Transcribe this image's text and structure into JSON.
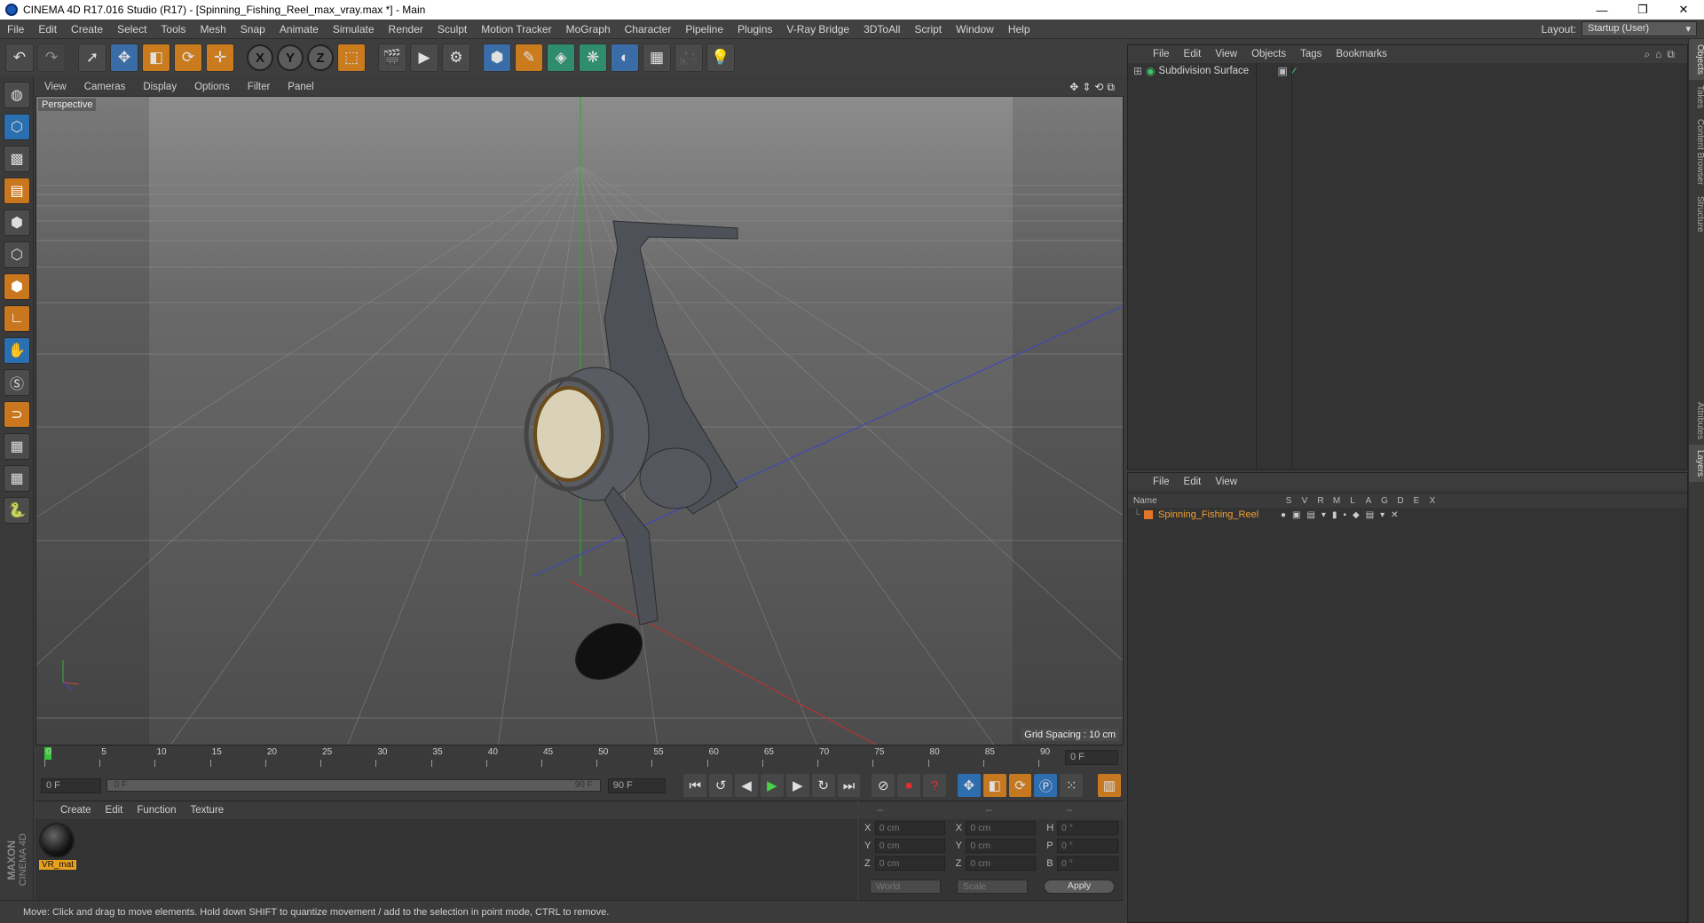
{
  "window": {
    "title": "CINEMA 4D R17.016 Studio (R17) - [Spinning_Fishing_Reel_max_vray.max *] - Main",
    "minimize": "—",
    "restore": "❐",
    "close": "✕"
  },
  "menubar": {
    "items": [
      "File",
      "Edit",
      "Create",
      "Select",
      "Tools",
      "Mesh",
      "Snap",
      "Animate",
      "Simulate",
      "Render",
      "Sculpt",
      "Motion Tracker",
      "MoGraph",
      "Character",
      "Pipeline",
      "Plugins",
      "V-Ray Bridge",
      "3DToAll",
      "Script",
      "Window",
      "Help"
    ],
    "layout_label": "Layout:",
    "layout_value": "Startup (User)"
  },
  "toolbar": {
    "x_label": "X",
    "y_label": "Y",
    "z_label": "Z"
  },
  "viewport": {
    "menu": [
      "View",
      "Cameras",
      "Display",
      "Options",
      "Filter",
      "Panel"
    ],
    "camera_label": "Perspective",
    "grid_spacing": "Grid Spacing : 10 cm"
  },
  "timeline": {
    "ticks": [
      "0",
      "5",
      "10",
      "15",
      "20",
      "25",
      "30",
      "35",
      "40",
      "45",
      "50",
      "55",
      "60",
      "65",
      "70",
      "75",
      "80",
      "85",
      "90"
    ],
    "current_frame": "0 F",
    "start_field": "0 F",
    "range_start": "0 F",
    "range_end": "90 F",
    "end_field": "90 F"
  },
  "materials": {
    "menu": [
      "Create",
      "Edit",
      "Function",
      "Texture"
    ],
    "items": [
      {
        "name": "VR_mat"
      }
    ]
  },
  "coordinates": {
    "headers": [
      "--",
      "--",
      "--"
    ],
    "rows": [
      {
        "a": "X",
        "av": "0 cm",
        "b": "X",
        "bv": "0 cm",
        "c": "H",
        "cv": "0 °"
      },
      {
        "a": "Y",
        "av": "0 cm",
        "b": "Y",
        "bv": "0 cm",
        "c": "P",
        "cv": "0 °"
      },
      {
        "a": "Z",
        "av": "0 cm",
        "b": "Z",
        "bv": "0 cm",
        "c": "B",
        "cv": "0 °"
      }
    ],
    "mode1": "World",
    "mode2": "Scale",
    "apply": "Apply"
  },
  "status": {
    "text": "Move: Click and drag to move elements. Hold down SHIFT to quantize movement / add to the selection in point mode, CTRL to remove."
  },
  "objects_panel": {
    "menu": [
      "File",
      "Edit",
      "View",
      "Objects",
      "Tags",
      "Bookmarks"
    ],
    "items": [
      {
        "name": "Subdivision Surface"
      }
    ]
  },
  "layers_panel": {
    "menu": [
      "File",
      "Edit",
      "View"
    ],
    "columns": {
      "name": "Name",
      "flags": [
        "S",
        "V",
        "R",
        "M",
        "L",
        "A",
        "G",
        "D",
        "E",
        "X"
      ]
    },
    "rows": [
      {
        "name": "Spinning_Fishing_Reel"
      }
    ]
  },
  "right_tabs": [
    "Objects",
    "Takes",
    "Content Browser",
    "Structure",
    "Attributes",
    "Layers"
  ],
  "branding": {
    "line1": "MAXON",
    "line2": "CINEMA 4D"
  },
  "colors": {
    "accent_blue": "#2a6fb0",
    "accent_orange": "#c9771e",
    "layer_name": "#f0a030"
  }
}
